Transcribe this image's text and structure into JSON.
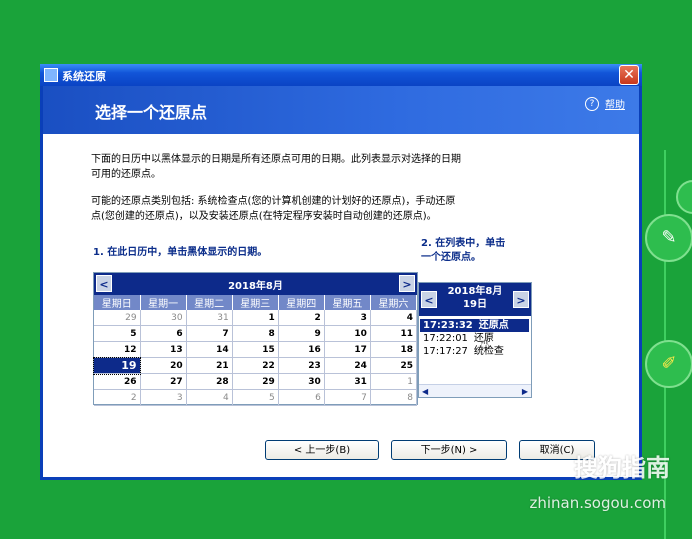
{
  "window": {
    "title": "系统还原",
    "close_glyph": "✕",
    "heading": "选择一个还原点",
    "help_label": "帮助"
  },
  "intro": {
    "line1": "下面的日历中以黑体显示的日期是所有还原点可用的日期。此列表显示对选择的日期",
    "line2": "可用的还原点。",
    "line3": "可能的还原点类别包括: 系统检查点(您的计算机创建的计划好的还原点)，手动还原",
    "line4": "点(您创建的还原点)，以及安装还原点(在特定程序安装时自动创建的还原点)。"
  },
  "steps": {
    "step1": "1. 在此日历中，单击黑体显示的日期。",
    "step2_line1": "2. 在列表中，单击",
    "step2_line2": "一个还原点。"
  },
  "calendar": {
    "month_title": "2018年8月",
    "prev": "<",
    "next": ">",
    "weekdays": [
      "星期日",
      "星期一",
      "星期二",
      "星期三",
      "星期四",
      "星期五",
      "星期六"
    ],
    "weeks": [
      [
        "29",
        "30",
        "31",
        "1",
        "2",
        "3",
        "4"
      ],
      [
        "5",
        "6",
        "7",
        "8",
        "9",
        "10",
        "11"
      ],
      [
        "12",
        "13",
        "14",
        "15",
        "16",
        "17",
        "18"
      ],
      [
        "19",
        "20",
        "21",
        "22",
        "23",
        "24",
        "25"
      ],
      [
        "26",
        "27",
        "28",
        "29",
        "30",
        "31",
        "1"
      ],
      [
        "2",
        "3",
        "4",
        "5",
        "6",
        "7",
        "8"
      ]
    ],
    "selected_day": "19"
  },
  "list": {
    "title_line1": "2018年8月",
    "title_line2": "19日",
    "items": [
      {
        "time": "17:23:32",
        "label": "还原点"
      },
      {
        "time": "17:22:01",
        "label": "还原"
      },
      {
        "time": "17:17:27",
        "label": "统检查"
      }
    ],
    "selected_index": 0
  },
  "buttons": {
    "back": "< 上一步(B)",
    "next": "下一步(N) >",
    "cancel": "取消(C)"
  },
  "watermark": {
    "brand": "搜狗指南",
    "url": "zhinan.sogou.com"
  },
  "colors": {
    "background": "#1aa33a",
    "banner": "#2f6be0",
    "selection": "#0d2a8a"
  }
}
